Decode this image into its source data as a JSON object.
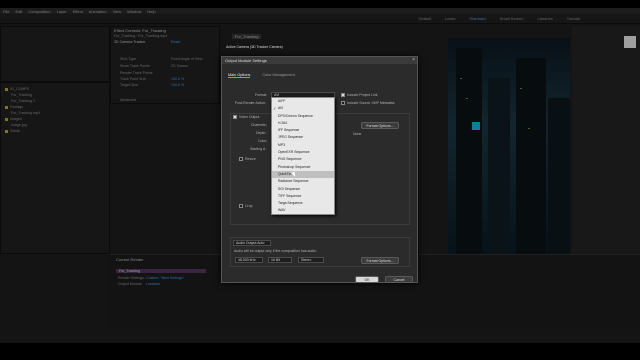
{
  "menu": [
    "File",
    "Edit",
    "Composition",
    "Layer",
    "Effect",
    "Animation",
    "View",
    "Window",
    "Help"
  ],
  "workspace_tabs": [
    "Default",
    "Learn",
    "Standard",
    "Small Screen",
    "Libraries",
    "Tutorial"
  ],
  "effects_panel": {
    "tab": "Effect Controls: For_Tracking",
    "breadcrumb": "For_Tracking · For_Tracking.mp4",
    "effect": "3D Camera Tracker",
    "reset": "Reset",
    "rows": [
      {
        "label": "Shot Type",
        "value": "Fixed Angle of View"
      },
      {
        "label": "Show Track Points",
        "value": "2D Source"
      },
      {
        "label": "Render Track Points",
        "value": ""
      },
      {
        "label": "Track Point Size",
        "value": "100.0 %"
      },
      {
        "label": "Target Size",
        "value": "100.0 %"
      },
      {
        "label": "Advanced",
        "value": ""
      }
    ]
  },
  "project_panel": {
    "items": [
      "01_COMPS",
      "For_Tracking",
      "For_Tracking 2",
      "Footage",
      "For_Tracking.mp4",
      "Images",
      "image.jpg",
      "Solids"
    ]
  },
  "comp_tab": "For_Tracking",
  "dialog": {
    "title": "Output Module Settings",
    "subtitle": "Active Camera (3D Tracker Camera)",
    "close": "×",
    "tabs": {
      "main": "Main Options",
      "color": "Color Management"
    },
    "format_label": "Format:",
    "format_value": "AVI",
    "post_render_label": "Post-Render Action:",
    "include_project_link": "Include Project Link",
    "include_xmp": "Include Source XMP Metadata",
    "video_output": "Video Output",
    "channels": "Channels:",
    "depth": "Depth:",
    "color": "Color:",
    "starting": "Starting #:",
    "format_options": "Format Options...",
    "none_label": "None",
    "resize": "Resize",
    "crop": "Crop",
    "audio_output": "Audio Output Auto",
    "audio_note": "Audio will be output only if the composition has audio.",
    "audio_rate": "48,000 kHz",
    "audio_bits": "16 Bit",
    "audio_ch": "Stereo",
    "audio_format_options": "Format Options...",
    "ok": "OK",
    "cancel": "Cancel"
  },
  "format_dropdown": {
    "items": [
      "AIFF",
      "AVI",
      "DPX/Cineon Sequence",
      "H.264",
      "IFF Sequence",
      "JPEG Sequence",
      "MP3",
      "OpenEXR Sequence",
      "PNG Sequence",
      "Photoshop Sequence",
      "QuickTime",
      "Radiance Sequence",
      "SGI Sequence",
      "TIFF Sequence",
      "Targa Sequence",
      "WAV"
    ],
    "checked": "AVI",
    "highlighted": "QuickTime"
  },
  "render_queue": {
    "tab": "Current Render",
    "item": "For_Tracking",
    "render_settings_label": "Render Settings:",
    "render_settings_value": "Custom: \"Best Settings\"",
    "output_module_label": "Output Module:",
    "output_module_value": "Lossless"
  }
}
